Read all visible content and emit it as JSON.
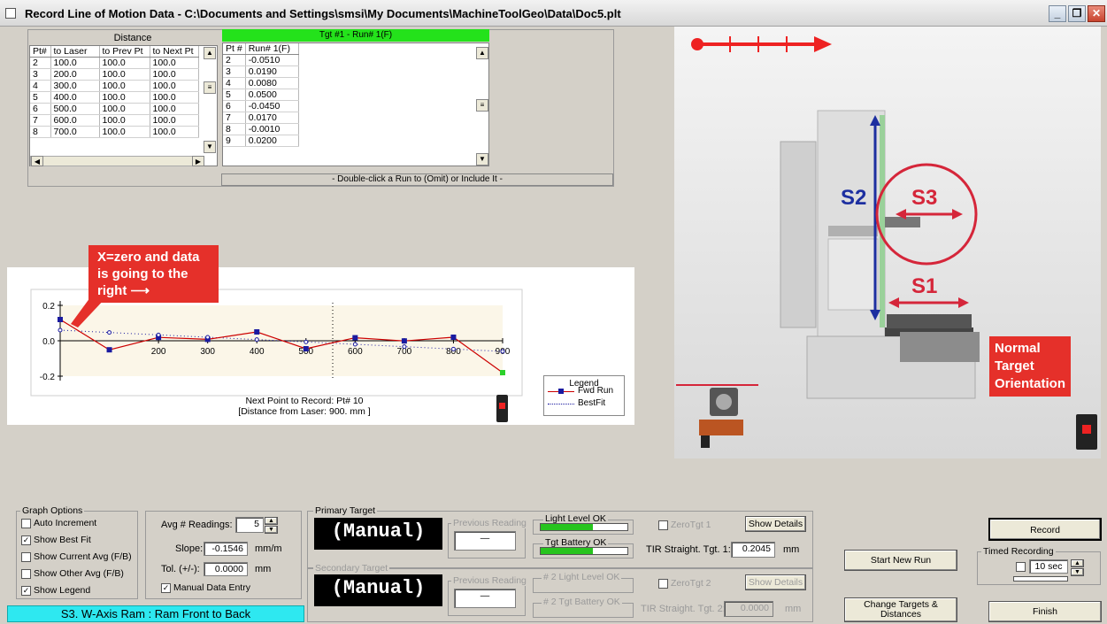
{
  "window": {
    "title": "Record Line of Motion Data - C:\\Documents and Settings\\smsi\\My Documents\\MachineToolGeo\\Data\\Doc5.plt",
    "min_label": "_",
    "max_label": "❐",
    "close_label": "✕"
  },
  "distance_table": {
    "caption": "Distance",
    "headers": [
      "Pt#",
      "to Laser",
      "to Prev Pt",
      "to Next Pt"
    ],
    "rows": [
      [
        "2",
        "100.0",
        "100.0",
        "100.0"
      ],
      [
        "3",
        "200.0",
        "100.0",
        "100.0"
      ],
      [
        "4",
        "300.0",
        "100.0",
        "100.0"
      ],
      [
        "5",
        "400.0",
        "100.0",
        "100.0"
      ],
      [
        "6",
        "500.0",
        "100.0",
        "100.0"
      ],
      [
        "7",
        "600.0",
        "100.0",
        "100.0"
      ],
      [
        "8",
        "700.0",
        "100.0",
        "100.0"
      ]
    ]
  },
  "run_table": {
    "header": "Tgt #1 - Run# 1(F)",
    "headers": [
      "Pt #",
      "Run# 1(F)"
    ],
    "rows": [
      [
        "2",
        "-0.0510"
      ],
      [
        "3",
        "0.0190"
      ],
      [
        "4",
        "0.0080"
      ],
      [
        "5",
        "0.0500"
      ],
      [
        "6",
        "-0.0450"
      ],
      [
        "7",
        "0.0170"
      ],
      [
        "8",
        "-0.0010"
      ],
      [
        "9",
        "0.0200"
      ]
    ],
    "hint": "- Double-click a Run to (Omit) or Include It -"
  },
  "chart_data": {
    "type": "line",
    "x_ticks": [
      "200",
      "300",
      "400",
      "500",
      "600",
      "700",
      "800",
      "900"
    ],
    "y_ticks": [
      "0.2",
      "0.0",
      "-0.2"
    ],
    "xlim": [
      0,
      900
    ],
    "ylim": [
      -0.2,
      0.2
    ],
    "series": [
      {
        "name": "Fwd Run",
        "color": "#cc0000",
        "x": [
          0,
          100,
          200,
          300,
          400,
          500,
          600,
          700,
          800,
          900
        ],
        "y": [
          0.12,
          -0.051,
          0.019,
          0.008,
          0.05,
          -0.045,
          0.017,
          -0.001,
          0.02,
          -0.18
        ]
      },
      {
        "name": "BestFit",
        "color": "#1a1aa0",
        "x": [
          0,
          900
        ],
        "y": [
          0.06,
          -0.06
        ]
      }
    ],
    "legend_title": "Legend",
    "next_point_text": "Next Point to Record: Pt# 10",
    "distance_text": "[Distance from Laser: 900. mm ]"
  },
  "annotations": {
    "callout": "X=zero and data is going to the right ⟶",
    "normal_target": "Normal Target Orientation",
    "s1": "S1",
    "s2": "S2",
    "s3": "S3"
  },
  "graph_options": {
    "title": "Graph Options",
    "items": [
      {
        "label": "Auto Increment",
        "checked": false
      },
      {
        "label": "Show Best Fit",
        "checked": true
      },
      {
        "label": "Show Current Avg (F/B)",
        "checked": false
      },
      {
        "label": "Show Other Avg (F/B)",
        "checked": false
      },
      {
        "label": "Show Legend",
        "checked": true
      }
    ]
  },
  "avg": {
    "readings_label": "Avg # Readings:",
    "readings_value": "5",
    "slope_label": "Slope:",
    "slope_value": "-0.1546",
    "slope_unit": "mm/m",
    "tol_label": "Tol. (+/-):",
    "tol_value": "0.0000",
    "tol_unit": "mm",
    "manual_entry_label": "Manual Data Entry"
  },
  "primary_target": {
    "title": "Primary Target",
    "display": "(Manual)",
    "prev_reading_label": "Previous Reading",
    "prev_reading_value": "—",
    "light_level_label": "Light Level OK",
    "light_level": 0.6,
    "battery_label": "Tgt Battery OK",
    "battery_level": 0.6,
    "zero_label": "ZeroTgt 1",
    "show_details": "Show Details",
    "tir_label": "TIR Straight. Tgt. 1:",
    "tir_value": "0.2045",
    "tir_unit": "mm"
  },
  "secondary_target": {
    "title": "Secondary Target",
    "display": "(Manual)",
    "prev_reading_label": "Previous Reading",
    "prev_reading_value": "—",
    "light_level_label": "# 2 Light Level OK",
    "battery_label": "# 2 Tgt Battery OK",
    "zero_label": "ZeroTgt 2",
    "show_details": "Show Details",
    "tir_label": "TIR Straight. Tgt. 2:",
    "tir_value": "0.0000",
    "tir_unit": "mm"
  },
  "actions": {
    "start_new_run": "Start New Run",
    "change_targets": "Change Targets & Distances",
    "record": "Record",
    "timed_recording_title": "Timed Recording",
    "timed_value": "10 sec",
    "finish": "Finish"
  },
  "status": "S3. W-Axis Ram : Ram Front to Back"
}
